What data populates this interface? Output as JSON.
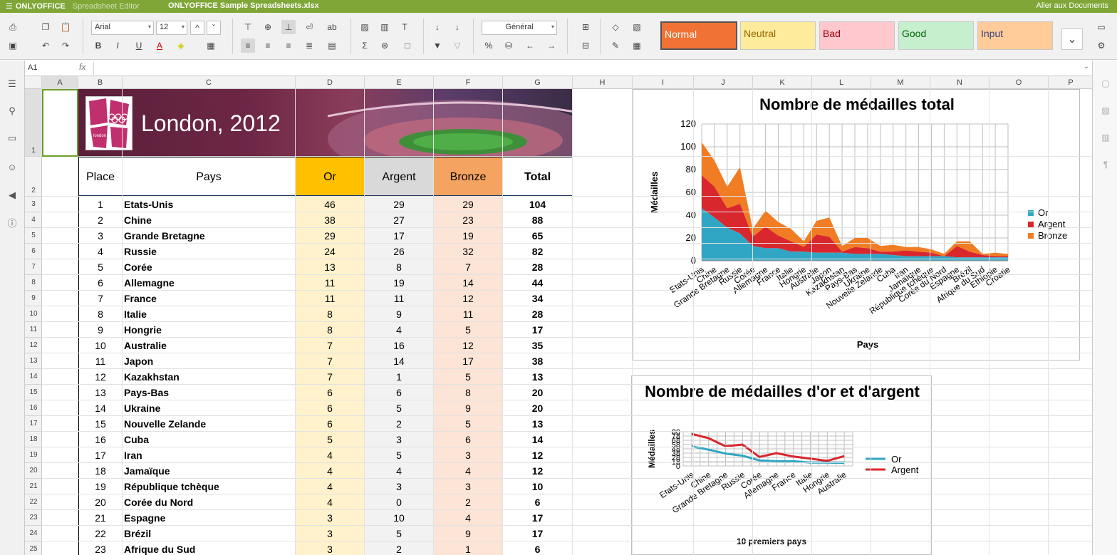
{
  "topbar": {
    "app": "ONLYOFFICE",
    "module": "Spreadsheet Editor",
    "document": "ONLYOFFICE Sample Spreadsheets.xlsx",
    "goto": "Aller aux Documents"
  },
  "toolbar": {
    "font_name": "Arial",
    "font_size": "12",
    "number_format": "Général",
    "styles": [
      {
        "label": "Normal",
        "bg": "#f07234",
        "fg": "#ffffff"
      },
      {
        "label": "Neutral",
        "bg": "#ffeb9c",
        "fg": "#9c6500"
      },
      {
        "label": "Bad",
        "bg": "#ffc7ce",
        "fg": "#9c0006"
      },
      {
        "label": "Good",
        "bg": "#c6efce",
        "fg": "#006100"
      },
      {
        "label": "Input",
        "bg": "#ffcc99",
        "fg": "#3f3f76"
      }
    ]
  },
  "formula_bar": {
    "cell_ref": "A1",
    "fx": "fx",
    "value": ""
  },
  "columns": [
    "A",
    "B",
    "C",
    "D",
    "E",
    "F",
    "G",
    "H",
    "I",
    "J",
    "K",
    "L",
    "M",
    "N",
    "O",
    "P"
  ],
  "rows": [
    "1",
    "2",
    "3",
    "4",
    "5",
    "6",
    "7",
    "8",
    "9",
    "10",
    "11",
    "12",
    "13",
    "14",
    "15",
    "16",
    "17",
    "18",
    "19",
    "20",
    "21",
    "22",
    "23",
    "24",
    "25"
  ],
  "banner": {
    "title": "London, 2012",
    "logo_text": "london"
  },
  "table": {
    "headers": {
      "place": "Place",
      "pays": "Pays",
      "or": "Or",
      "argent": "Argent",
      "bronze": "Bronze",
      "total": "Total"
    },
    "rows": [
      [
        "1",
        "Etats-Unis",
        "46",
        "29",
        "29",
        "104"
      ],
      [
        "2",
        "Chine",
        "38",
        "27",
        "23",
        "88"
      ],
      [
        "3",
        "Grande Bretagne",
        "29",
        "17",
        "19",
        "65"
      ],
      [
        "4",
        "Russie",
        "24",
        "26",
        "32",
        "82"
      ],
      [
        "5",
        "Corée",
        "13",
        "8",
        "7",
        "28"
      ],
      [
        "6",
        "Allemagne",
        "11",
        "19",
        "14",
        "44"
      ],
      [
        "7",
        "France",
        "11",
        "11",
        "12",
        "34"
      ],
      [
        "8",
        "Italie",
        "8",
        "9",
        "11",
        "28"
      ],
      [
        "9",
        "Hongrie",
        "8",
        "4",
        "5",
        "17"
      ],
      [
        "10",
        "Australie",
        "7",
        "16",
        "12",
        "35"
      ],
      [
        "11",
        "Japon",
        "7",
        "14",
        "17",
        "38"
      ],
      [
        "12",
        "Kazakhstan",
        "7",
        "1",
        "5",
        "13"
      ],
      [
        "13",
        "Pays-Bas",
        "6",
        "6",
        "8",
        "20"
      ],
      [
        "14",
        "Ukraine",
        "6",
        "5",
        "9",
        "20"
      ],
      [
        "15",
        "Nouvelle Zelande",
        "6",
        "2",
        "5",
        "13"
      ],
      [
        "16",
        "Cuba",
        "5",
        "3",
        "6",
        "14"
      ],
      [
        "17",
        "Iran",
        "4",
        "5",
        "3",
        "12"
      ],
      [
        "18",
        "Jamaïque",
        "4",
        "4",
        "4",
        "12"
      ],
      [
        "19",
        "République tchèque",
        "4",
        "3",
        "3",
        "10"
      ],
      [
        "20",
        "Corée du Nord",
        "4",
        "0",
        "2",
        "6"
      ],
      [
        "21",
        "Espagne",
        "3",
        "10",
        "4",
        "17"
      ],
      [
        "22",
        "Brézil",
        "3",
        "5",
        "9",
        "17"
      ],
      [
        "23",
        "Afrique du Sud",
        "3",
        "2",
        "1",
        "6"
      ]
    ]
  },
  "colors": {
    "or": "#ffc000",
    "or_light": "#fff2cc",
    "argent": "#d9d9d9",
    "argent_light": "#f2f2f2",
    "bronze": "#f4a460",
    "bronze_light": "#fce4d6",
    "series_or": "#31a6c4",
    "series_argent": "#d9272e",
    "series_bronze": "#f07d23"
  },
  "chart_data": [
    {
      "type": "area",
      "stacked": true,
      "title": "Nombre de médailles total",
      "xlabel": "Pays",
      "ylabel": "Médailles",
      "ylim": [
        0,
        120
      ],
      "yticks": [
        0,
        20,
        40,
        60,
        80,
        100,
        120
      ],
      "grid": true,
      "legend": "right",
      "categories": [
        "Etats-Unis",
        "Chine",
        "Grande Bretagne",
        "Russie",
        "Corée",
        "Allemagne",
        "France",
        "Italie",
        "Hongrie",
        "Australie",
        "Japon",
        "Kazakhstan",
        "Pays-Bas",
        "Ukraine",
        "Nouvelle Zelande",
        "Cuba",
        "Iran",
        "Jamaïque",
        "République tchèque",
        "Corée du Nord",
        "Espagne",
        "Brézil",
        "Afrique du Sud",
        "Ethiopie",
        "Croatie"
      ],
      "series": [
        {
          "name": "Or",
          "values": [
            46,
            38,
            29,
            24,
            13,
            11,
            11,
            8,
            8,
            7,
            7,
            7,
            6,
            6,
            6,
            5,
            4,
            4,
            4,
            4,
            3,
            3,
            3,
            3,
            3
          ]
        },
        {
          "name": "Argent",
          "values": [
            29,
            27,
            17,
            26,
            8,
            19,
            11,
            9,
            4,
            16,
            14,
            1,
            6,
            5,
            2,
            3,
            5,
            4,
            3,
            0,
            10,
            5,
            2,
            1,
            1
          ]
        },
        {
          "name": "Bronze",
          "values": [
            29,
            23,
            19,
            32,
            7,
            14,
            12,
            11,
            5,
            12,
            17,
            5,
            8,
            9,
            5,
            6,
            3,
            4,
            3,
            2,
            4,
            9,
            1,
            3,
            2
          ]
        }
      ]
    },
    {
      "type": "line",
      "title": "Nombre de médailles d'or et d'argent",
      "xlabel": "10 premiers pays",
      "ylabel": "Médailles",
      "ylim": [
        0,
        80
      ],
      "yticks": [
        0,
        10,
        20,
        30,
        40,
        50,
        60,
        70,
        80
      ],
      "ytick_labels": [
        "0",
        "18",
        "28",
        "38",
        "48",
        "58",
        "68",
        "78",
        "80"
      ],
      "grid": true,
      "legend": "right",
      "categories": [
        "Etats-Unis",
        "Chine",
        "Grande Bretagne",
        "Russie",
        "Corée",
        "Allemagne",
        "France",
        "Italie",
        "Hongrie",
        "Australie"
      ],
      "series": [
        {
          "name": "Or",
          "values": [
            46,
            38,
            29,
            24,
            13,
            11,
            11,
            8,
            8,
            7
          ]
        },
        {
          "name": "Argent",
          "values": [
            75,
            65,
            46,
            50,
            21,
            30,
            22,
            17,
            12,
            23
          ]
        }
      ]
    }
  ]
}
